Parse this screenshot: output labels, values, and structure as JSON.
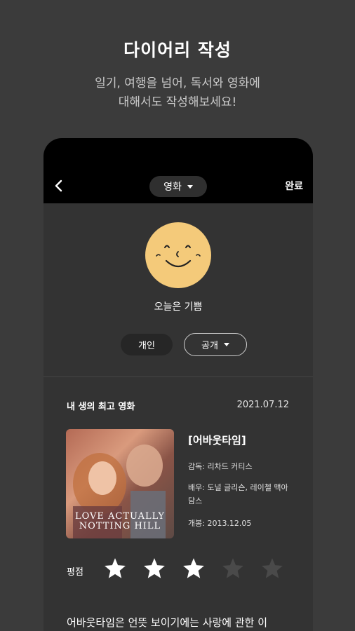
{
  "headline": "다이어리 작성",
  "subline": [
    "일기, 여행을 넘어, 독서와 영화에",
    "대해서도 작성해보세요!"
  ],
  "app": {
    "category": "영화",
    "done_label": "완료"
  },
  "mood": {
    "label": "오늘은 기쁨",
    "face_color": "#f4ca7a"
  },
  "visibility": {
    "private_label": "개인",
    "public_label": "공개"
  },
  "entry": {
    "title": "내 생의 최고 영화",
    "date": "2021.07.12"
  },
  "movie": {
    "title": "[어바웃타임]",
    "director": "감독: 리차드 커티스",
    "cast": "배우: 도널 글리슨, 레이첼 맥아담스",
    "release": "개봉: 2013.12.05",
    "poster_caption": [
      "LOVE ACTUALLY",
      "NOTTING HILL"
    ]
  },
  "rating": {
    "label": "평점",
    "value": 3,
    "max": 5
  },
  "review_preview": "어바웃타임은 언뜻 보이기에는 사랑에 관한 이"
}
